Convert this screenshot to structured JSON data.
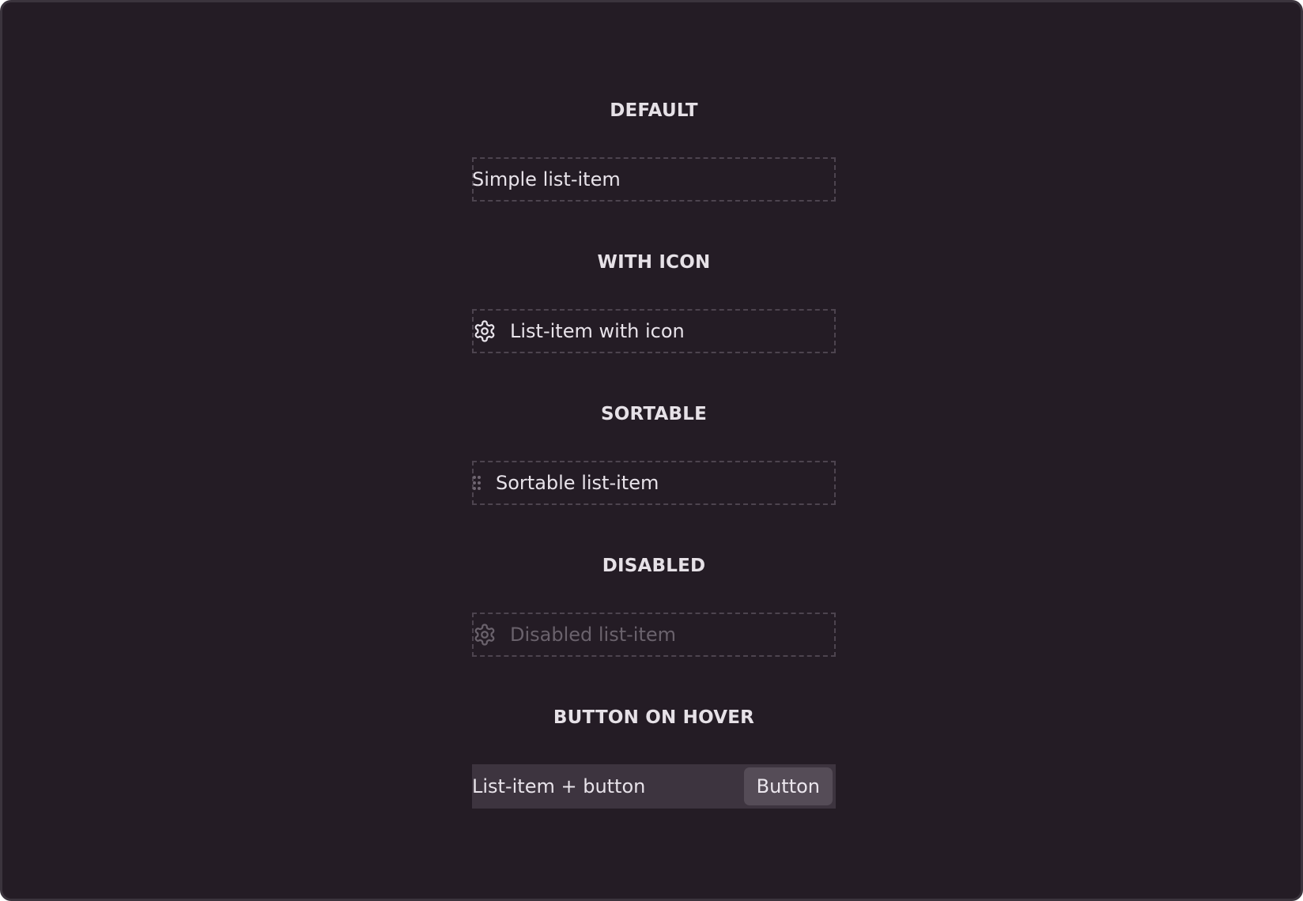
{
  "sections": {
    "default": {
      "title": "DEFAULT",
      "item_label": "Simple list-item"
    },
    "with_icon": {
      "title": "WITH ICON",
      "item_label": "List-item with icon",
      "icon": "gear-icon"
    },
    "sortable": {
      "title": "SORTABLE",
      "item_label": "Sortable list-item",
      "icon": "drag-handle-icon"
    },
    "disabled": {
      "title": "DISABLED",
      "item_label": "Disabled list-item",
      "icon": "gear-icon"
    },
    "button_on_hover": {
      "title": "BUTTON ON HOVER",
      "item_label": "List-item + button",
      "button_label": "Button"
    }
  },
  "colors": {
    "background": "#241c25",
    "text": "#e8e3ea",
    "disabled_text": "#6a626c",
    "dashed_border": "#4d444f",
    "hover_background": "#3d343f",
    "button_background": "#554c57"
  }
}
